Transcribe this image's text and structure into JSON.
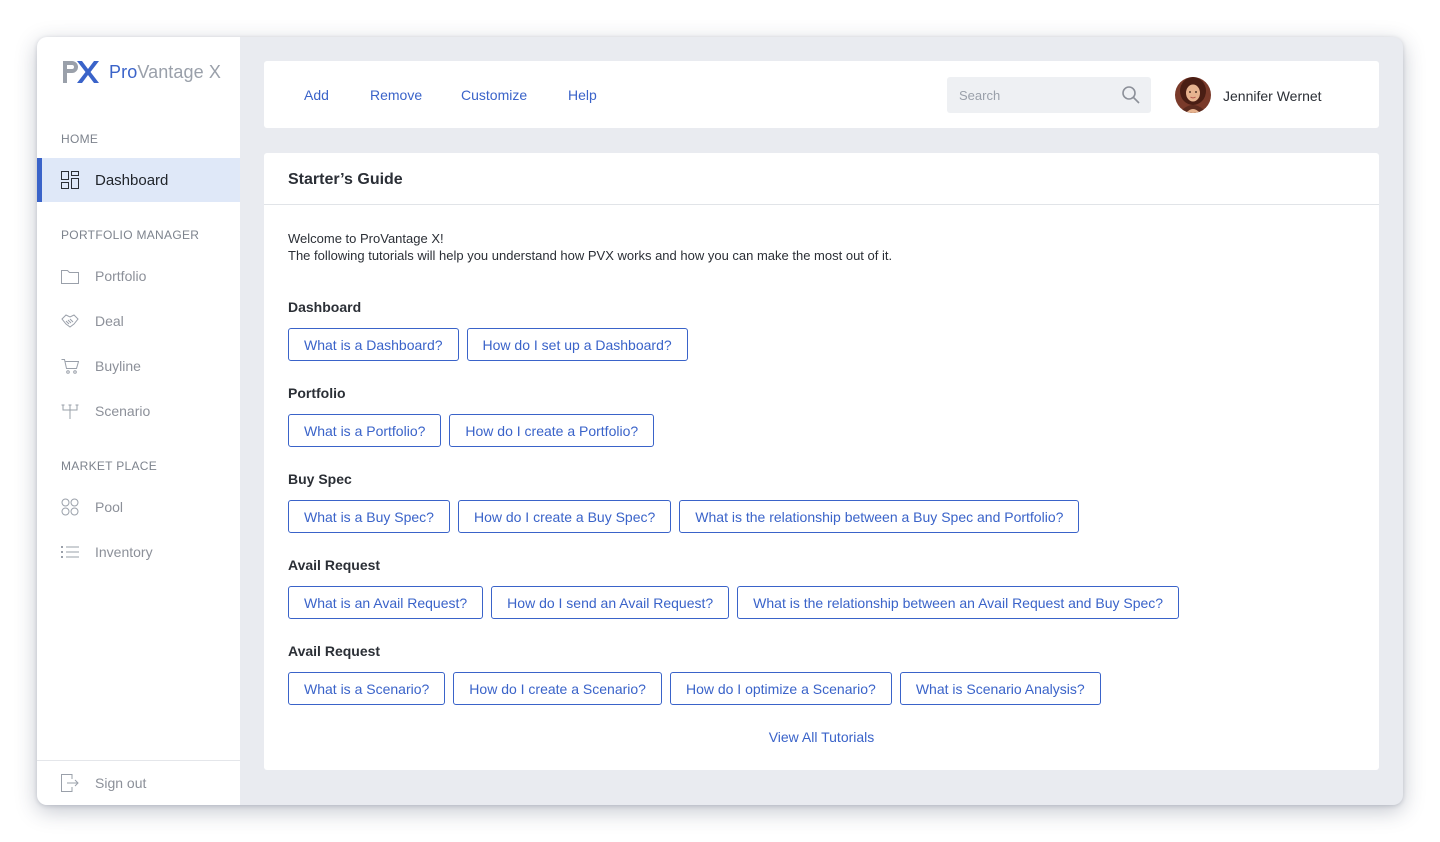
{
  "brand": {
    "prefix": "Pro",
    "suffix": "Vantage X",
    "mark_text": "PX"
  },
  "colors": {
    "accent": "#3a63c9",
    "active_bg": "#dfe8f8",
    "canvas": "#e9ebf0"
  },
  "sidebar": {
    "sections": [
      {
        "label": "HOME"
      },
      {
        "label": "PORTFOLIO MANAGER"
      },
      {
        "label": "MARKET PLACE"
      }
    ],
    "items": [
      {
        "label": "Dashboard",
        "icon": "dashboard-icon",
        "active": true
      },
      {
        "label": "Portfolio",
        "icon": "folder-icon"
      },
      {
        "label": "Deal",
        "icon": "handshake-icon"
      },
      {
        "label": "Buyline",
        "icon": "cart-icon"
      },
      {
        "label": "Scenario",
        "icon": "branch-icon"
      },
      {
        "label": "Pool",
        "icon": "pool-icon"
      },
      {
        "label": "Inventory",
        "icon": "list-icon"
      }
    ],
    "signout_label": "Sign out"
  },
  "topbar": {
    "links": [
      "Add",
      "Remove",
      "Customize",
      "Help"
    ],
    "search_placeholder": "Search",
    "user_name": "Jennifer Wernet"
  },
  "guide": {
    "title": "Starter’s Guide",
    "intro_line1": "Welcome to ProVantage X!",
    "intro_line2": "The following tutorials will help you understand how PVX works and how you can make the most out of it.",
    "groups": [
      {
        "title": "Dashboard",
        "buttons": [
          "What is a Dashboard?",
          "How do I set up a Dashboard?"
        ]
      },
      {
        "title": "Portfolio",
        "buttons": [
          "What is a Portfolio?",
          "How do I create a Portfolio?"
        ]
      },
      {
        "title": "Buy Spec",
        "buttons": [
          "What is a Buy Spec?",
          "How do I create a Buy Spec?",
          "What is the relationship between a Buy Spec and Portfolio?"
        ]
      },
      {
        "title": "Avail Request",
        "buttons": [
          "What is an Avail Request?",
          "How do I send an Avail Request?",
          "What is the relationship between an Avail Request and Buy Spec?"
        ]
      },
      {
        "title": "Avail Request",
        "buttons": [
          "What is a Scenario?",
          "How do I create a Scenario?",
          "How do I optimize a Scenario?",
          "What is Scenario Analysis?"
        ]
      }
    ],
    "view_all_label": "View All Tutorials"
  }
}
